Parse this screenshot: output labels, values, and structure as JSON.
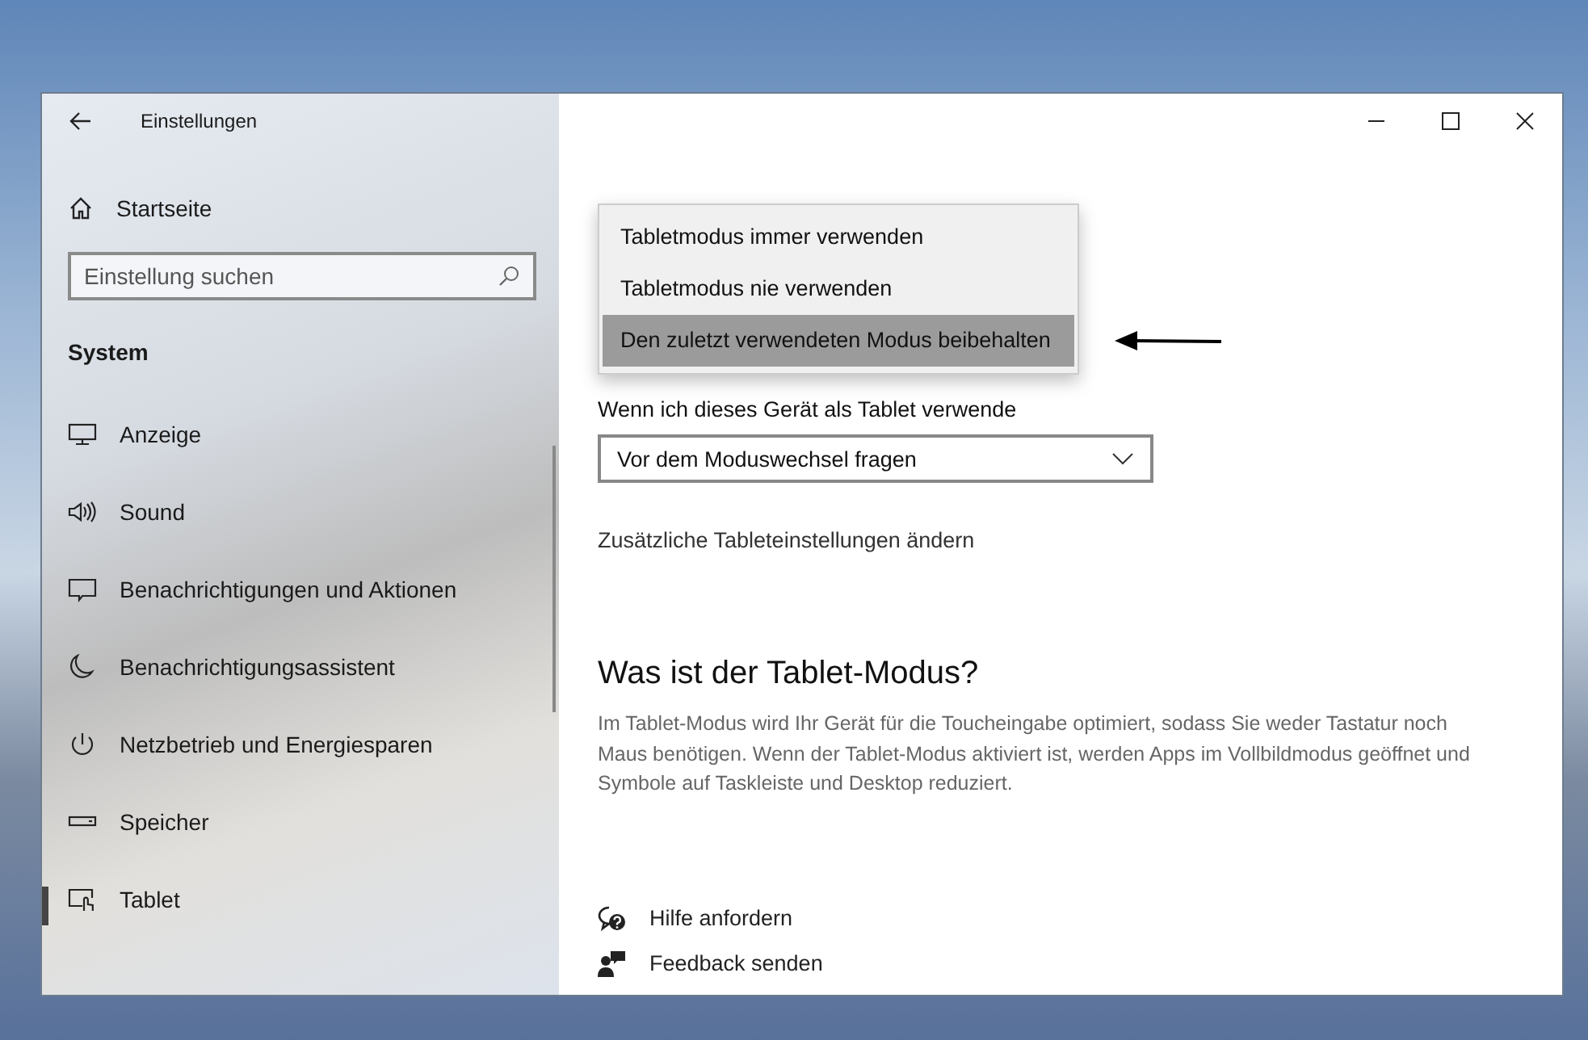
{
  "window": {
    "title": "Einstellungen"
  },
  "sidebar": {
    "home": "Startseite",
    "search": {
      "placeholder": "Einstellung suchen"
    },
    "section": "System",
    "items": [
      {
        "label": "Anzeige",
        "kind": "display",
        "selected": false
      },
      {
        "label": "Sound",
        "kind": "sound",
        "selected": false
      },
      {
        "label": "Benachrichtigungen und Aktionen",
        "kind": "notification",
        "selected": false
      },
      {
        "label": "Benachrichtigungsassistent",
        "kind": "moon",
        "selected": false
      },
      {
        "label": "Netzbetrieb und Energiesparen",
        "kind": "power",
        "selected": false
      },
      {
        "label": "Speicher",
        "kind": "storage",
        "selected": false
      },
      {
        "label": "Tablet",
        "kind": "tablet",
        "selected": true
      }
    ]
  },
  "main": {
    "dropdown_menu": [
      {
        "label": "Tabletmodus immer verwenden",
        "selected": false
      },
      {
        "label": "Tabletmodus nie verwenden",
        "selected": false
      },
      {
        "label": "Den zuletzt verwendeten Modus beibehalten",
        "selected": true
      }
    ],
    "setting_label": "Wenn ich dieses Gerät als Tablet verwende",
    "select_value": "Vor dem Moduswechsel fragen",
    "link": "Zusätzliche Tableteinstellungen ändern",
    "info_heading": "Was ist der Tablet-Modus?",
    "info_text": "Im Tablet-Modus wird Ihr Gerät für die Toucheingabe optimiert, sodass Sie weder Tastatur noch Maus benötigen. Wenn der Tablet-Modus aktiviert ist, werden Apps im Vollbildmodus geöffnet und Symbole auf Taskleiste und Desktop reduziert.",
    "help_links": [
      {
        "label": "Hilfe anfordern",
        "kind": "help"
      },
      {
        "label": "Feedback senden",
        "kind": "feedback"
      }
    ]
  }
}
